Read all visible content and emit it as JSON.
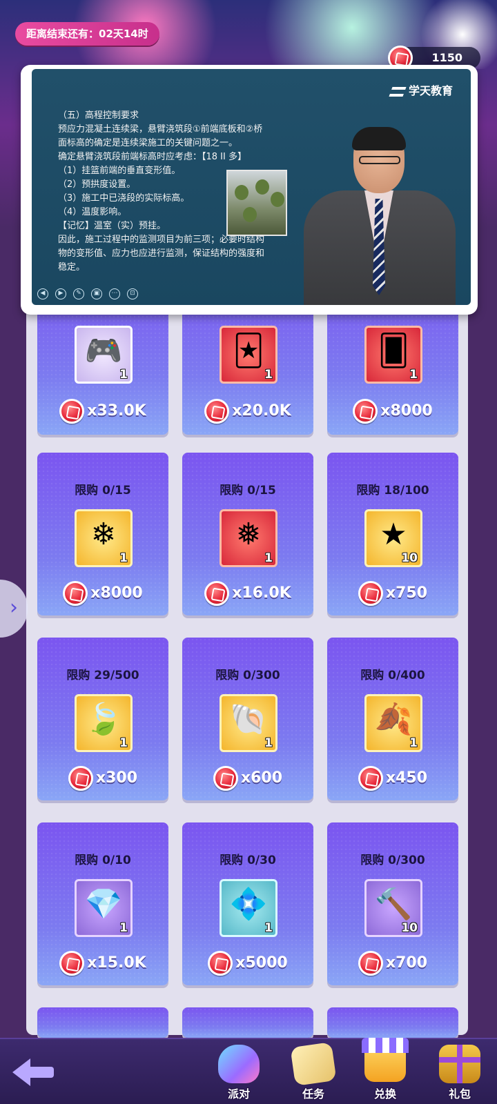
{
  "header": {
    "countdown_text": "距离结束还有：02天14时",
    "coin_balance": "1150"
  },
  "video": {
    "brand": "学天教育",
    "lines": [
      "（五）高程控制要求",
      "预应力混凝土连续梁，悬臂浇筑段①前端底板和②桥",
      "面标高的确定是连续梁施工的关键问题之一。",
      "确定悬臂浇筑段前端标高时应考虑：【18 II 多】",
      "（1）挂篮前端的垂直变形值。",
      "（2）预拱度设置。",
      "（3）施工中已浇段的实际标高。",
      "（4）温度影响。",
      "【记忆】温室（实）预挂。",
      "因此，施工过程中的监测项目为前三项；必要时结构",
      "物的变形值、应力也应进行监测，保证结构的强度和",
      "稳定。"
    ]
  },
  "shop": {
    "items": [
      {
        "limit": "",
        "tile": "lav",
        "icon": "gamepad-icon",
        "glyph": "🎮",
        "count": "1",
        "price": "x33.0K"
      },
      {
        "limit": "",
        "tile": "red",
        "icon": "card-icon",
        "glyph": "🃏",
        "count": "1",
        "price": "x20.0K"
      },
      {
        "limit": "",
        "tile": "red",
        "icon": "card-icon",
        "glyph": "🂠",
        "count": "1",
        "price": "x8000"
      },
      {
        "limit": "限购 0/15",
        "tile": "yellow",
        "icon": "snowflake-icon",
        "glyph": "❄",
        "count": "1",
        "price": "x8000"
      },
      {
        "limit": "限购 0/15",
        "tile": "red",
        "icon": "snowflake-icon",
        "glyph": "❅",
        "count": "1",
        "price": "x16.0K"
      },
      {
        "limit": "限购 18/100",
        "tile": "yellow",
        "icon": "star-icon",
        "glyph": "★",
        "count": "10",
        "price": "x750"
      },
      {
        "limit": "限购 29/500",
        "tile": "yellow",
        "icon": "pearl-leaf-icon",
        "glyph": "🍃",
        "count": "1",
        "price": "x300"
      },
      {
        "limit": "限购 0/300",
        "tile": "yellow",
        "icon": "pearl-shell-icon",
        "glyph": "🐚",
        "count": "1",
        "price": "x600"
      },
      {
        "limit": "限购 0/400",
        "tile": "yellow",
        "icon": "pearl-leaf-icon",
        "glyph": "🍂",
        "count": "1",
        "price": "x450"
      },
      {
        "limit": "限购 0/10",
        "tile": "purple",
        "icon": "gem-cube-icon",
        "glyph": "💎",
        "count": "1",
        "price": "x15.0K"
      },
      {
        "limit": "限购 0/30",
        "tile": "teal",
        "icon": "gem-cube-icon",
        "glyph": "💠",
        "count": "1",
        "price": "x5000"
      },
      {
        "limit": "限购 0/300",
        "tile": "purple",
        "icon": "hammer-icon",
        "glyph": "🔨",
        "count": "10",
        "price": "x700"
      }
    ]
  },
  "nav": {
    "party": "派对",
    "task": "任务",
    "exchange": "兑换",
    "gift": "礼包"
  }
}
